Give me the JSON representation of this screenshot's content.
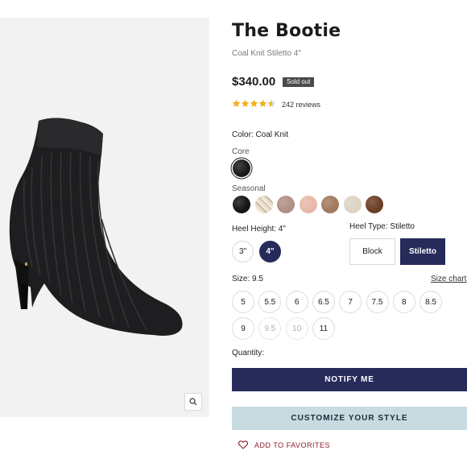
{
  "product": {
    "title": "The Bootie",
    "subtitle": "Coal Knit Stiletto 4\"",
    "price": "$340.00",
    "badge": "Sold out",
    "rating": 4.5,
    "reviews": "242 reviews"
  },
  "color": {
    "label": "Color: Coal Knit",
    "core_label": "Core",
    "seasonal_label": "Seasonal",
    "core": [
      {
        "name": "coal-knit",
        "hex": "#1a1a1a",
        "selected": true
      }
    ],
    "seasonal": [
      {
        "name": "black",
        "hex": "#151515"
      },
      {
        "name": "snake-print",
        "hex": "#d9cdbd"
      },
      {
        "name": "mauve",
        "hex": "#b08f84"
      },
      {
        "name": "blush",
        "hex": "#e7b9a8"
      },
      {
        "name": "tan",
        "hex": "#a27a5f"
      },
      {
        "name": "cream",
        "hex": "#ddd5c4"
      },
      {
        "name": "brown",
        "hex": "#6b3f25"
      }
    ]
  },
  "heel_height": {
    "label": "Heel Height: 4\"",
    "options": [
      "3\"",
      "4\""
    ],
    "selected": "4\""
  },
  "heel_type": {
    "label": "Heel Type: Stiletto",
    "options": [
      "Block",
      "Stiletto"
    ],
    "selected": "Stiletto"
  },
  "size": {
    "label": "Size: 9.5",
    "size_chart": "Size chart",
    "row1": [
      "5",
      "5.5",
      "6",
      "6.5",
      "7",
      "7.5",
      "8",
      "8.5"
    ],
    "row2": [
      "9",
      "9.5",
      "10",
      "11"
    ],
    "unavailable": [
      "9.5",
      "10"
    ]
  },
  "quantity_label": "Quantity:",
  "actions": {
    "notify": "NOTIFY ME",
    "customize": "CUSTOMIZE YOUR STYLE",
    "favorite": "ADD TO FAVORITES"
  },
  "colors": {
    "primary": "#262b5a",
    "accent_blue": "#c7dbe1",
    "star": "#f2b01e",
    "favorite": "#8a1c2b"
  }
}
